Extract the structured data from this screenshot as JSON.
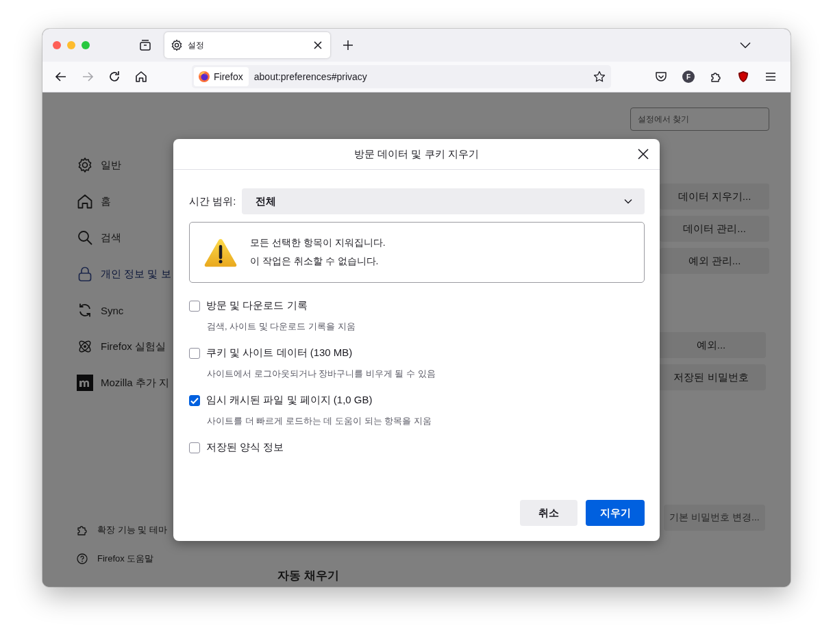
{
  "browser": {
    "tabs": [
      {
        "label": "설정",
        "selected": true
      }
    ],
    "nav_buttons": [
      {
        "disabled": false
      },
      {
        "disabled": true
      },
      {
        "disabled": false
      },
      {
        "disabled": false
      }
    ],
    "url_bar": {
      "identity": "Firefox",
      "url": "about:preferences#privacy"
    },
    "account_initial": "F"
  },
  "settings": {
    "search": {
      "placeholder": "설정에서 찾기"
    },
    "sidebar": {
      "items": [
        {
          "label": "일반",
          "selected": false
        },
        {
          "label": "홈",
          "selected": false
        },
        {
          "label": "검색",
          "selected": false
        },
        {
          "label": "개인 정보 및 보",
          "selected": true
        },
        {
          "label": "Sync",
          "selected": false
        },
        {
          "label": "Firefox 실험실",
          "selected": false
        },
        {
          "label": "Mozilla 추가 지",
          "selected": false
        }
      ],
      "footer_links": [
        "확장 기능 및 테마",
        "Firefox 도움말"
      ]
    },
    "button_groups": [
      [
        {
          "label": "데이터 지우기...",
          "disabled": false
        },
        {
          "label": "데이터 관리...",
          "disabled": false
        },
        {
          "label": "예외 관리...",
          "disabled": false
        }
      ],
      [
        {
          "label": "예외...",
          "disabled": false
        },
        {
          "label": "저장된 비밀번호",
          "disabled": false
        }
      ],
      [
        {
          "label": "기본 비밀번호 변경...",
          "disabled": true
        }
      ]
    ],
    "heading": "자동 채우기"
  },
  "dialog": {
    "title": "방문 데이터 및 쿠키 지우기",
    "time_range": {
      "label": "시간 범위:",
      "value": "전체"
    },
    "warning": [
      "모든 선택한 항목이 지워집니다.",
      "이 작업은 취소할 수 없습니다."
    ],
    "options": [
      {
        "label": "방문 및 다운로드 기록",
        "description": "검색, 사이트 및 다운로드 기록을 지움",
        "checked": false
      },
      {
        "label": "쿠키 및 사이트 데이터 (130 MB)",
        "description": "사이트에서 로그아웃되거나 장바구니를 비우게 될 수 있음",
        "checked": false
      },
      {
        "label": "임시 캐시된 파일 및 페이지 (1,0 GB)",
        "description": "사이트를 더 빠르게 로드하는 데 도움이 되는 항목을 지움",
        "checked": true
      },
      {
        "label": "저장된 양식 정보",
        "checked": false
      }
    ],
    "buttons": [
      {
        "label": "취소",
        "kind": "secondary"
      },
      {
        "label": "지우기",
        "kind": "primary"
      }
    ]
  }
}
